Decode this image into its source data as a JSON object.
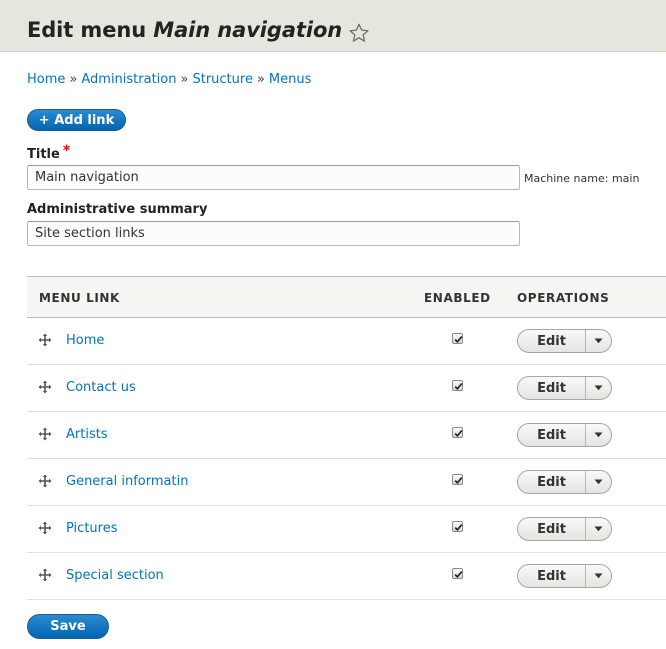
{
  "page": {
    "title_prefix": "Edit menu ",
    "title_menu_name": "Main navigation"
  },
  "breadcrumb": [
    {
      "label": "Home"
    },
    {
      "label": "Administration"
    },
    {
      "label": "Structure"
    },
    {
      "label": "Menus"
    }
  ],
  "breadcrumb_separator": "»",
  "actions": {
    "add_link_label": "+ Add link",
    "save_label": "Save"
  },
  "form": {
    "title_label": "Title",
    "required_marker": "*",
    "title_value": "Main navigation",
    "machine_name": "Machine name: main",
    "summary_label": "Administrative summary",
    "summary_value": "Site section links"
  },
  "table": {
    "headers": {
      "menu_link": "MENU LINK",
      "enabled": "ENABLED",
      "operations": "OPERATIONS"
    },
    "rows": [
      {
        "label": "Home",
        "enabled": true,
        "edit_label": "Edit"
      },
      {
        "label": "Contact us",
        "enabled": true,
        "edit_label": "Edit"
      },
      {
        "label": "Artists",
        "enabled": true,
        "edit_label": "Edit"
      },
      {
        "label": "General informatin",
        "enabled": true,
        "edit_label": "Edit"
      },
      {
        "label": "Pictures",
        "enabled": true,
        "edit_label": "Edit"
      },
      {
        "label": "Special section",
        "enabled": true,
        "edit_label": "Edit"
      }
    ]
  },
  "colors": {
    "link": "#0074bd",
    "primary_button": "#0071b8",
    "header_band": "#e6e6df",
    "required": "#e00000"
  },
  "icons": {
    "favorite": "star-outline-icon",
    "drag": "move-cross-icon",
    "dropdown": "caret-down-icon",
    "check": "checkmark-icon"
  }
}
